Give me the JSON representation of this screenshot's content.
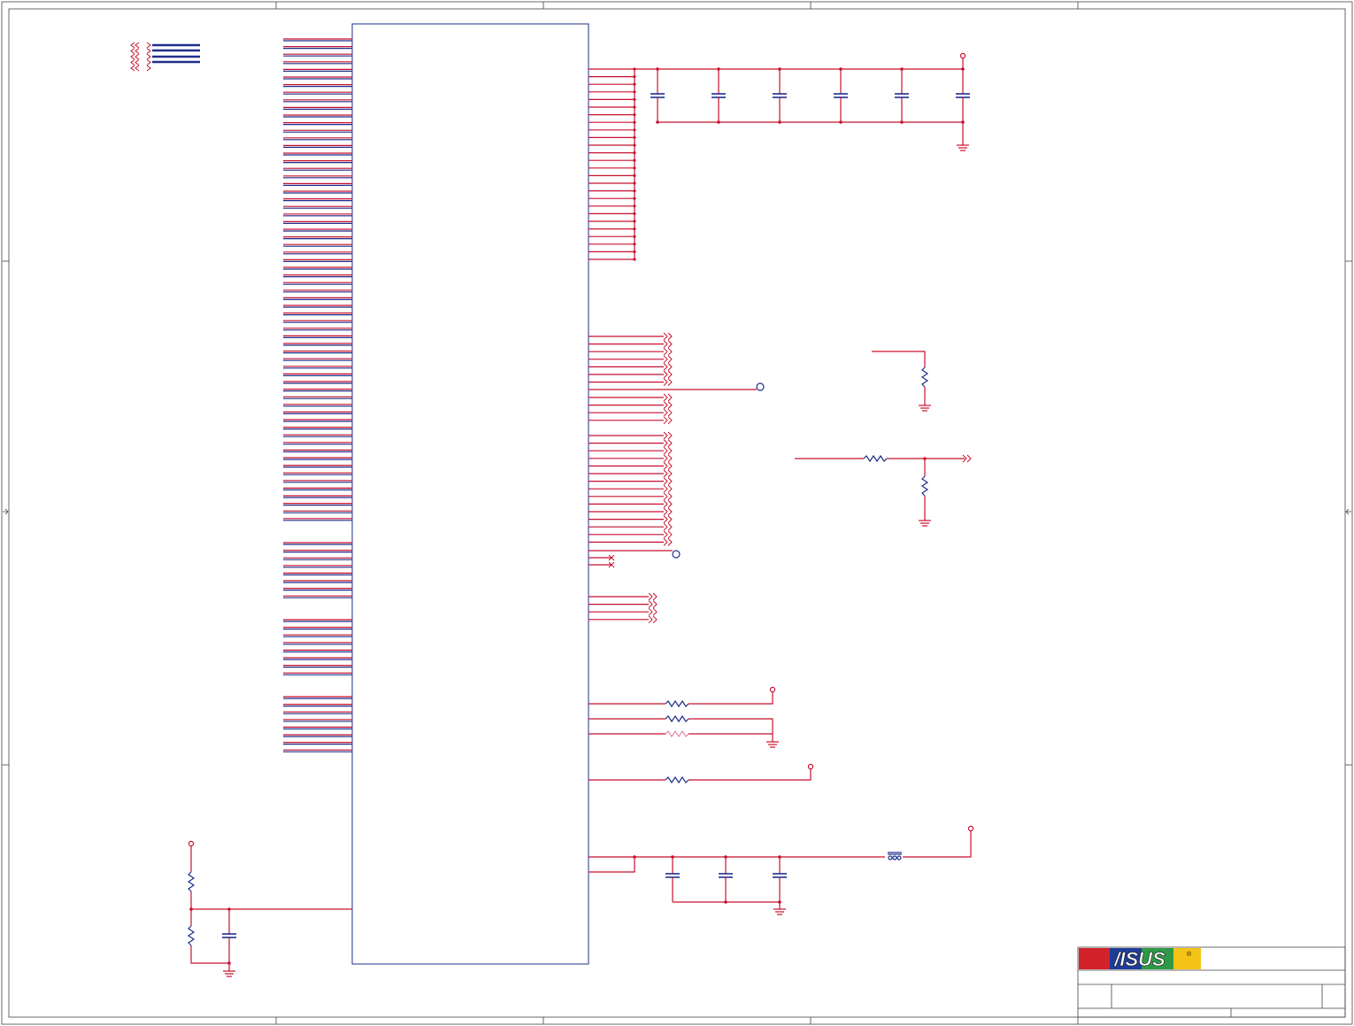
{
  "title_block": {
    "logo_text": "/ISUS",
    "registered_mark": "®",
    "brand_colors": {
      "red": "#d2232a",
      "blue": "#1f3c99",
      "green": "#2e9a47",
      "yellow": "#f3c316",
      "white": "#ffffff"
    }
  },
  "colors": {
    "wire": "#c8102e",
    "component": "#1f2f8a",
    "frame": "#444444"
  }
}
